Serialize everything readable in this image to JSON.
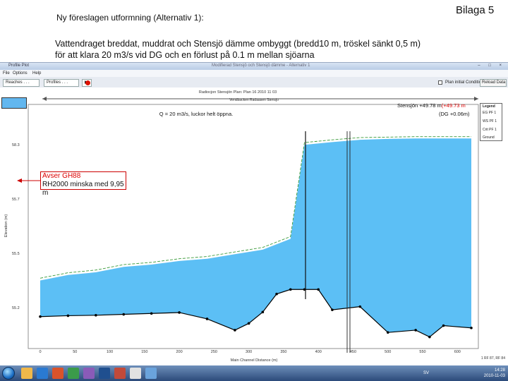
{
  "doc": {
    "title": "Ny föreslagen utformning (Alternativ 1):",
    "badge": "Bilaga 5",
    "desc_line1": "Vattendraget breddat, muddrat och Stensjö dämme ombyggt (bredd10 m, tröskel sänkt 0,5 m)",
    "desc_line2": "för att klara 20 m3/s vid DG och en förlust på 0.1 m mellan sjöarna"
  },
  "window": {
    "title": "Profile Plot",
    "center_title": "Modifierad Stensjö och Stensjö dämme - Alternativ 1",
    "controls": "– □ ×"
  },
  "menu": [
    "File",
    "Options",
    "Help"
  ],
  "toolbar": {
    "reaches_label": "Reaches . . .",
    "profiles_label": "Profiles . . .",
    "plan_label": "Plan initial Conditions",
    "reload_label": "Reload Data"
  },
  "plot": {
    "title": "Radiocjon Stensjön    Plan: Plan 16    2010 11 03",
    "subtitle": "Vendbacken Radaasen Stensjo",
    "y_axis_label": "Elevation (m)",
    "x_axis_label": "Main Channel Distance (m)",
    "y_ticks": [
      "58.3",
      "55.7",
      "55.5",
      "55.2"
    ],
    "x_ticks": [
      "0",
      "50",
      "100",
      "150",
      "200",
      "250",
      "300",
      "350",
      "400",
      "450",
      "500",
      "550",
      "600"
    ],
    "legend": {
      "title": "Legend",
      "items": [
        "EG PF 1",
        "WS PF 1",
        "Crit PF 1",
        "Ground"
      ]
    },
    "annotation_flow": "Q = 20 m3/s, luckor helt öppna.",
    "annotation_stensjon_a": "Stensjön +49.78 m",
    "annotation_stensjon_b": "(+49.73 m",
    "annotation_dg": "(DG +0.06m)",
    "annotation_box_line1": "Avser GH88",
    "annotation_box_line2": "RH2000 minska med 9,95 m",
    "corner_label": "1 RF 87, RF 84"
  },
  "chart_data": {
    "type": "line",
    "title": "Radiocjon Stensjön    Plan: Plan 16    2010 11 03",
    "xlabel": "Main Channel Distance (m)",
    "ylabel": "Elevation (m)",
    "xlim": [
      0,
      620
    ],
    "series": [
      {
        "name": "WS PF 1",
        "x": [
          0,
          40,
          80,
          120,
          160,
          200,
          240,
          280,
          320,
          360,
          380,
          420,
          460,
          500,
          540,
          580,
          620
        ],
        "values": [
          55.2,
          55.32,
          55.38,
          55.5,
          55.55,
          55.63,
          55.68,
          55.78,
          55.88,
          56.12,
          58.2,
          58.26,
          58.31,
          58.33,
          58.34,
          58.34,
          58.34
        ]
      },
      {
        "name": "EG PF 1",
        "x": [
          0,
          40,
          80,
          120,
          160,
          200,
          240,
          280,
          320,
          360,
          380,
          420,
          460,
          500,
          540,
          580,
          620
        ],
        "values": [
          55.25,
          55.37,
          55.43,
          55.55,
          55.6,
          55.68,
          55.73,
          55.83,
          55.93,
          56.17,
          58.25,
          58.31,
          58.36,
          58.37,
          58.38,
          58.38,
          58.38
        ]
      },
      {
        "name": "Ground",
        "x": [
          0,
          40,
          80,
          120,
          160,
          200,
          240,
          280,
          300,
          320,
          340,
          360,
          380,
          400,
          420,
          460,
          500,
          540,
          560,
          580,
          620
        ],
        "values": [
          54.4,
          54.42,
          54.43,
          54.45,
          54.47,
          54.49,
          54.35,
          54.1,
          54.25,
          54.5,
          54.9,
          55.0,
          55.0,
          55.0,
          54.55,
          54.62,
          54.05,
          54.1,
          53.95,
          54.2,
          54.15
        ]
      }
    ]
  },
  "taskbar": {
    "lang": "SV",
    "time": "14:28",
    "date": "2010-11-03"
  },
  "colors": {
    "water": "#5cbff5",
    "ground": "#000000",
    "energy_grade": "#3a9a3a",
    "window_frame": "#b9cce6",
    "annotation_red": "#dd0000"
  }
}
